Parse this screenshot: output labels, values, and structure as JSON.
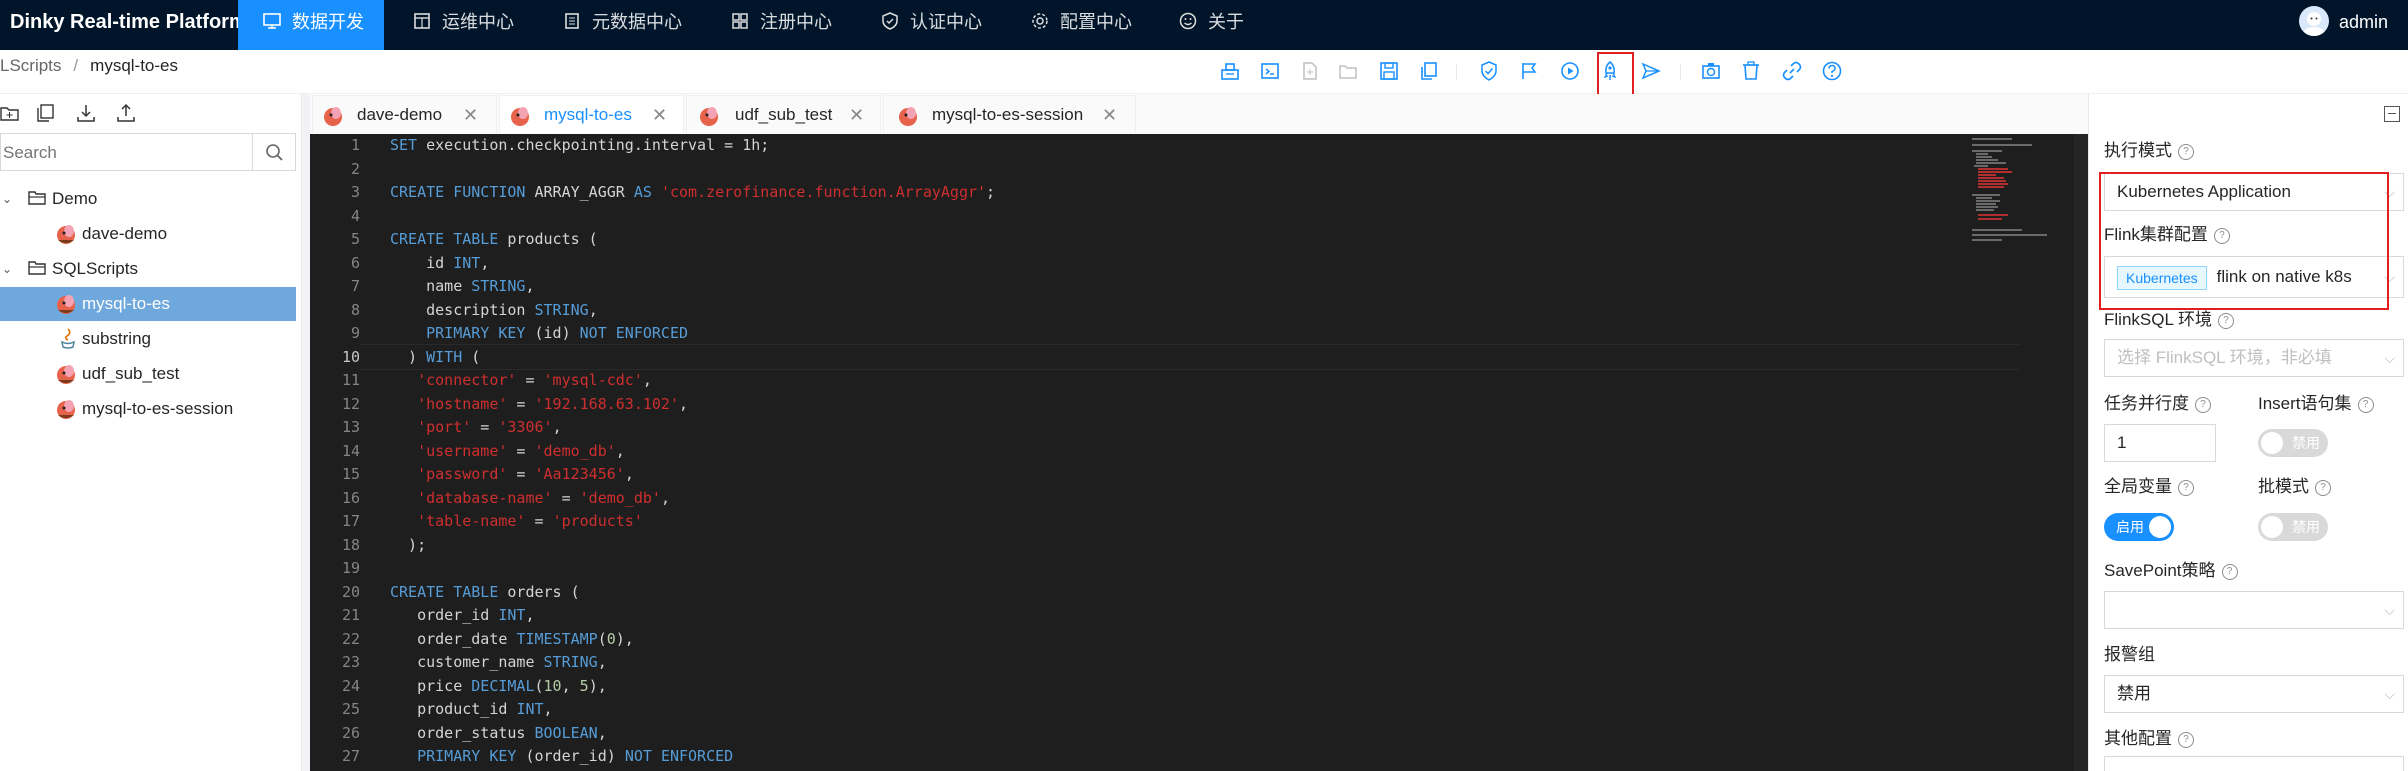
{
  "header": {
    "brand": "Dinky Real-time Platform",
    "nav": [
      {
        "label": "数据开发",
        "icon": "desktop-icon",
        "active": true
      },
      {
        "label": "运维中心",
        "icon": "calendar-icon",
        "active": false
      },
      {
        "label": "元数据中心",
        "icon": "database-icon",
        "active": false
      },
      {
        "label": "注册中心",
        "icon": "appstore-icon",
        "active": false
      },
      {
        "label": "认证中心",
        "icon": "shield-icon",
        "active": false
      },
      {
        "label": "配置中心",
        "icon": "gear-icon",
        "active": false
      },
      {
        "label": "关于",
        "icon": "smile-icon",
        "active": false
      }
    ],
    "user": "admin"
  },
  "breadcrumb": {
    "parent": "LScripts",
    "current": "mysql-to-es"
  },
  "toolbar": {
    "buttons": [
      "cluster-icon",
      "console-icon",
      "new-file-icon",
      "open-folder-icon",
      "save-icon",
      "copy-icon",
      "check-icon",
      "flag-icon",
      "play-icon",
      "deploy-icon",
      "send-icon",
      "camera-icon",
      "delete-icon",
      "link-icon",
      "help-icon"
    ],
    "highlighted": "deploy-icon"
  },
  "sidebar": {
    "search_placeholder": "Search",
    "tree": [
      {
        "label": "Demo",
        "type": "folder",
        "level": 0
      },
      {
        "label": "dave-demo",
        "type": "flink",
        "level": 1
      },
      {
        "label": "SQLScripts",
        "type": "folder",
        "level": 0
      },
      {
        "label": "mysql-to-es",
        "type": "flink",
        "level": 1,
        "selected": true
      },
      {
        "label": "substring",
        "type": "java",
        "level": 1
      },
      {
        "label": "udf_sub_test",
        "type": "flink",
        "level": 1
      },
      {
        "label": "mysql-to-es-session",
        "type": "flink",
        "level": 1
      }
    ]
  },
  "tabs": [
    {
      "label": "dave-demo",
      "active": false
    },
    {
      "label": "mysql-to-es",
      "active": true
    },
    {
      "label": "udf_sub_test",
      "active": false
    },
    {
      "label": "mysql-to-es-session",
      "active": false
    }
  ],
  "editor": {
    "current_line": 10,
    "line_numbers": [
      "1",
      "2",
      "3",
      "4",
      "5",
      "6",
      "7",
      "8",
      "9",
      "10",
      "11",
      "12",
      "13",
      "14",
      "15",
      "16",
      "17",
      "18",
      "19",
      "20",
      "21",
      "22",
      "23",
      "24",
      "25",
      "26",
      "27"
    ],
    "lines": [
      "SET execution.checkpointing.interval = 1h;",
      "",
      "CREATE FUNCTION ARRAY_AGGR AS 'com.zerofinance.function.ArrayAggr';",
      "",
      "CREATE TABLE products (",
      "    id INT,",
      "    name STRING,",
      "    description STRING,",
      "    PRIMARY KEY (id) NOT ENFORCED",
      "  ) WITH (",
      "   'connector' = 'mysql-cdc',",
      "   'hostname' = '192.168.63.102',",
      "   'port' = '3306',",
      "   'username' = 'demo_db',",
      "   'password' = 'Aa123456',",
      "   'database-name' = 'demo_db',",
      "   'table-name' = 'products'",
      "  );",
      "",
      "CREATE TABLE orders (",
      "   order_id INT,",
      "   order_date TIMESTAMP(0),",
      "   customer_name STRING,",
      "   price DECIMAL(10, 5),",
      "   product_id INT,",
      "   order_status BOOLEAN,",
      "   PRIMARY KEY (order_id) NOT ENFORCED"
    ]
  },
  "settings": {
    "exec_mode_label": "执行模式",
    "exec_mode_value": "Kubernetes Application",
    "cluster_label": "Flink集群配置",
    "cluster_tag": "Kubernetes",
    "cluster_value": "flink on native k8s",
    "env_label": "FlinkSQL 环境",
    "env_placeholder": "选择 FlinkSQL 环境，非必填",
    "parallelism_label": "任务并行度",
    "parallelism_value": "1",
    "insert_label": "Insert语句集",
    "insert_switch": "禁用",
    "global_var_label": "全局变量",
    "global_var_switch": "启用",
    "batch_label": "批模式",
    "batch_switch": "禁用",
    "savepoint_label": "SavePoint策略",
    "alert_label": "报警组",
    "alert_value": "禁用",
    "other_label": "其他配置"
  },
  "colors": {
    "accent": "#1890ff",
    "header_bg": "#001529",
    "highlight": "#e02020",
    "selected_row": "#6fa8dc"
  }
}
